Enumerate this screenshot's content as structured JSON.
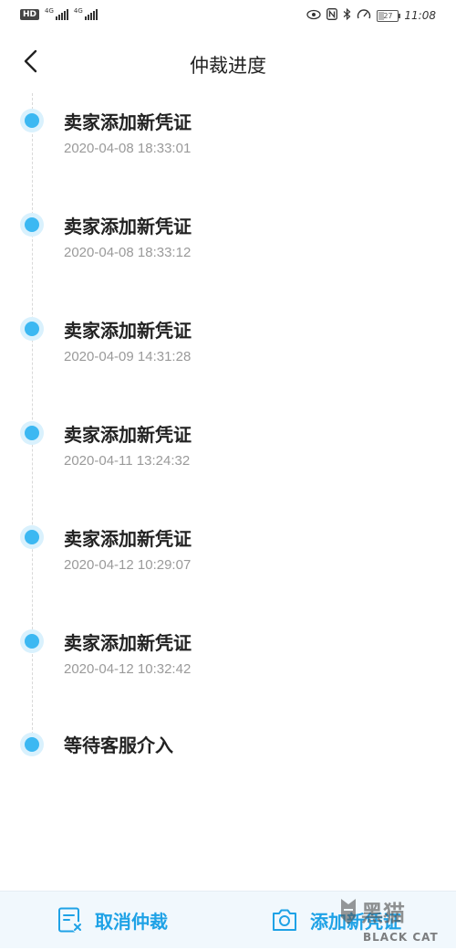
{
  "status_bar": {
    "hd": "HD",
    "sim1_label": "4G",
    "sim2_label": "4G",
    "battery": "27",
    "time": "11:08",
    "icons": [
      "eye-icon",
      "nfc-icon",
      "bluetooth-icon",
      "speedometer-icon"
    ]
  },
  "header": {
    "title": "仲裁进度",
    "back_icon": "chevron-left-icon"
  },
  "timeline": {
    "items": [
      {
        "title": "卖家添加新凭证",
        "time": "2020-04-08 18:33:01"
      },
      {
        "title": "卖家添加新凭证",
        "time": "2020-04-08 18:33:12"
      },
      {
        "title": "卖家添加新凭证",
        "time": "2020-04-09 14:31:28"
      },
      {
        "title": "卖家添加新凭证",
        "time": "2020-04-11 13:24:32"
      },
      {
        "title": "卖家添加新凭证",
        "time": "2020-04-12 10:29:07"
      },
      {
        "title": "卖家添加新凭证",
        "time": "2020-04-12 10:32:42"
      },
      {
        "title": "等待客服介入",
        "time": ""
      }
    ],
    "accent": "#3cb8f2"
  },
  "bottom_bar": {
    "cancel_label": "取消仲裁",
    "add_label": "添加新凭证",
    "cancel_icon": "cancel-document-icon",
    "add_icon": "camera-icon",
    "color": "#1fa2e6"
  },
  "watermark": {
    "text": "BLACK CAT",
    "logo": "黑猫"
  }
}
